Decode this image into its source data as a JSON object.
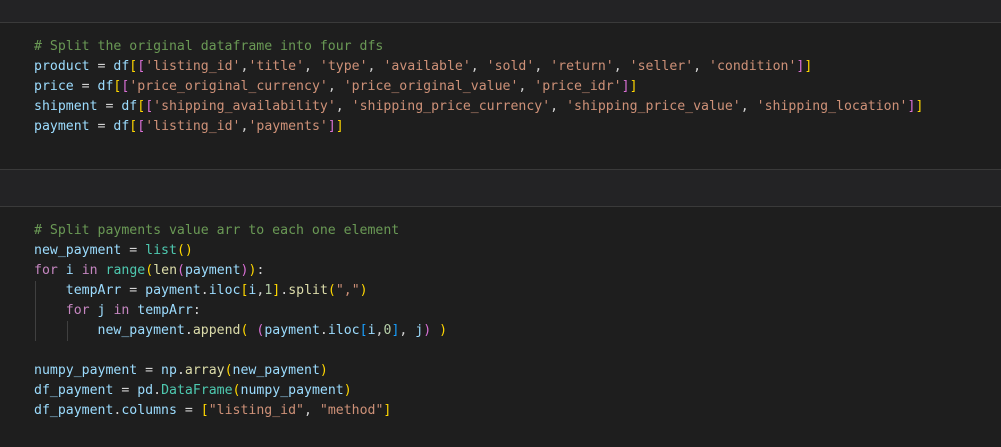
{
  "cells": [
    {
      "name": "cell-split-dataframe",
      "lines": [
        [
          [
            "cm",
            "# Split the original dataframe into four dfs"
          ]
        ],
        [
          [
            "var",
            "product"
          ],
          [
            "op",
            " = "
          ],
          [
            "var",
            "df"
          ],
          [
            "b1",
            "["
          ],
          [
            "b2",
            "["
          ],
          [
            "str",
            "'listing_id'"
          ],
          [
            "op",
            ","
          ],
          [
            "str",
            "'title'"
          ],
          [
            "op",
            ", "
          ],
          [
            "str",
            "'type'"
          ],
          [
            "op",
            ", "
          ],
          [
            "str",
            "'available'"
          ],
          [
            "op",
            ", "
          ],
          [
            "str",
            "'sold'"
          ],
          [
            "op",
            ", "
          ],
          [
            "str",
            "'return'"
          ],
          [
            "op",
            ", "
          ],
          [
            "str",
            "'seller'"
          ],
          [
            "op",
            ", "
          ],
          [
            "str",
            "'condition'"
          ],
          [
            "b2",
            "]"
          ],
          [
            "b1",
            "]"
          ]
        ],
        [
          [
            "var",
            "price"
          ],
          [
            "op",
            " = "
          ],
          [
            "var",
            "df"
          ],
          [
            "b1",
            "["
          ],
          [
            "b2",
            "["
          ],
          [
            "str",
            "'price_original_currency'"
          ],
          [
            "op",
            ", "
          ],
          [
            "str",
            "'price_original_value'"
          ],
          [
            "op",
            ", "
          ],
          [
            "str",
            "'price_idr'"
          ],
          [
            "b2",
            "]"
          ],
          [
            "b1",
            "]"
          ]
        ],
        [
          [
            "var",
            "shipment"
          ],
          [
            "op",
            " = "
          ],
          [
            "var",
            "df"
          ],
          [
            "b1",
            "["
          ],
          [
            "b2",
            "["
          ],
          [
            "str",
            "'shipping_availability'"
          ],
          [
            "op",
            ", "
          ],
          [
            "str",
            "'shipping_price_currency'"
          ],
          [
            "op",
            ", "
          ],
          [
            "str",
            "'shipping_price_value'"
          ],
          [
            "op",
            ", "
          ],
          [
            "str",
            "'shipping_location'"
          ],
          [
            "b2",
            "]"
          ],
          [
            "b1",
            "]"
          ]
        ],
        [
          [
            "var",
            "payment"
          ],
          [
            "op",
            " = "
          ],
          [
            "var",
            "df"
          ],
          [
            "b1",
            "["
          ],
          [
            "b2",
            "["
          ],
          [
            "str",
            "'listing_id'"
          ],
          [
            "op",
            ","
          ],
          [
            "str",
            "'payments'"
          ],
          [
            "b2",
            "]"
          ],
          [
            "b1",
            "]"
          ]
        ]
      ]
    },
    {
      "name": "cell-split-payments",
      "lines": [
        [
          [
            "cm",
            "# Split payments value arr to each one element"
          ]
        ],
        [
          [
            "var",
            "new_payment"
          ],
          [
            "op",
            " = "
          ],
          [
            "bi",
            "list"
          ],
          [
            "b1",
            "("
          ],
          [
            "b1",
            ")"
          ]
        ],
        [
          [
            "kw",
            "for"
          ],
          [
            "op",
            " "
          ],
          [
            "var",
            "i"
          ],
          [
            "op",
            " "
          ],
          [
            "kw",
            "in"
          ],
          [
            "op",
            " "
          ],
          [
            "bi",
            "range"
          ],
          [
            "b1",
            "("
          ],
          [
            "fn",
            "len"
          ],
          [
            "b2",
            "("
          ],
          [
            "var",
            "payment"
          ],
          [
            "b2",
            ")"
          ],
          [
            "b1",
            ")"
          ],
          [
            "op",
            ":"
          ]
        ],
        [
          [
            "op",
            "    "
          ],
          [
            "var",
            "tempArr"
          ],
          [
            "op",
            " = "
          ],
          [
            "var",
            "payment"
          ],
          [
            "op",
            "."
          ],
          [
            "var",
            "iloc"
          ],
          [
            "b1",
            "["
          ],
          [
            "var",
            "i"
          ],
          [
            "op",
            ","
          ],
          [
            "num",
            "1"
          ],
          [
            "b1",
            "]"
          ],
          [
            "op",
            "."
          ],
          [
            "fn",
            "split"
          ],
          [
            "b1",
            "("
          ],
          [
            "str",
            "\",\""
          ],
          [
            "b1",
            ")"
          ]
        ],
        [
          [
            "op",
            "    "
          ],
          [
            "kw",
            "for"
          ],
          [
            "op",
            " "
          ],
          [
            "var",
            "j"
          ],
          [
            "op",
            " "
          ],
          [
            "kw",
            "in"
          ],
          [
            "op",
            " "
          ],
          [
            "var",
            "tempArr"
          ],
          [
            "op",
            ":"
          ]
        ],
        [
          [
            "op",
            "        "
          ],
          [
            "var",
            "new_payment"
          ],
          [
            "op",
            "."
          ],
          [
            "fn",
            "append"
          ],
          [
            "b1",
            "("
          ],
          [
            "op",
            " "
          ],
          [
            "b2",
            "("
          ],
          [
            "var",
            "payment"
          ],
          [
            "op",
            "."
          ],
          [
            "var",
            "iloc"
          ],
          [
            "b3",
            "["
          ],
          [
            "var",
            "i"
          ],
          [
            "op",
            ","
          ],
          [
            "num",
            "0"
          ],
          [
            "b3",
            "]"
          ],
          [
            "op",
            ", "
          ],
          [
            "var",
            "j"
          ],
          [
            "b2",
            ")"
          ],
          [
            "op",
            " "
          ],
          [
            "b1",
            ")"
          ]
        ],
        [],
        [
          [
            "var",
            "numpy_payment"
          ],
          [
            "op",
            " = "
          ],
          [
            "var",
            "np"
          ],
          [
            "op",
            "."
          ],
          [
            "fn",
            "array"
          ],
          [
            "b1",
            "("
          ],
          [
            "var",
            "new_payment"
          ],
          [
            "b1",
            ")"
          ]
        ],
        [
          [
            "var",
            "df_payment"
          ],
          [
            "op",
            " = "
          ],
          [
            "var",
            "pd"
          ],
          [
            "op",
            "."
          ],
          [
            "bi",
            "DataFrame"
          ],
          [
            "b1",
            "("
          ],
          [
            "var",
            "numpy_payment"
          ],
          [
            "b1",
            ")"
          ]
        ],
        [
          [
            "var",
            "df_payment"
          ],
          [
            "op",
            "."
          ],
          [
            "var",
            "columns"
          ],
          [
            "op",
            " = "
          ],
          [
            "b1",
            "["
          ],
          [
            "str",
            "\"listing_id\""
          ],
          [
            "op",
            ", "
          ],
          [
            "str",
            "\"method\""
          ],
          [
            "b1",
            "]"
          ]
        ]
      ]
    }
  ],
  "colors": {
    "background": "#1e1e1e",
    "comment": "#6a9955",
    "variable": "#9cdcfe",
    "string": "#ce9178",
    "keyword": "#c586c0",
    "function": "#dcdcaa",
    "builtin": "#4ec9b0",
    "number": "#b5cea8",
    "bracket_level_1": "#ffd700",
    "bracket_level_2": "#da70d6",
    "bracket_level_3": "#179fff"
  }
}
